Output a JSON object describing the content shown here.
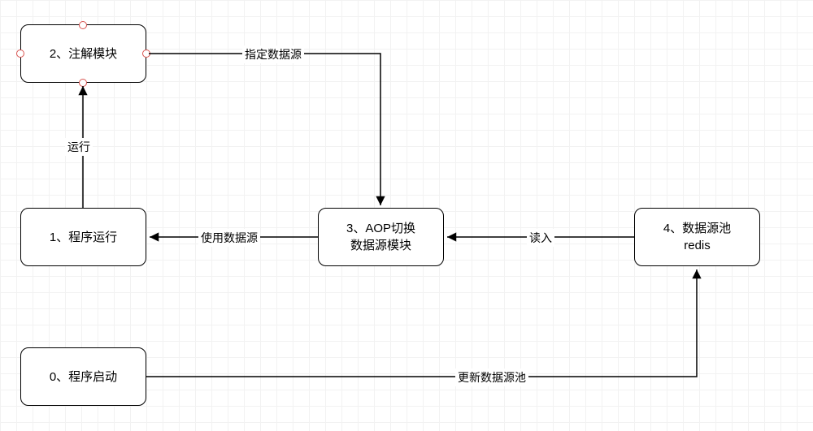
{
  "nodes": {
    "n0": {
      "label": "0、程序启动"
    },
    "n1": {
      "label": "1、程序运行"
    },
    "n2": {
      "label": "2、注解模块"
    },
    "n3": {
      "label": "3、AOP切换\n数据源模块"
    },
    "n4": {
      "label": "4、数据源池\nredis"
    }
  },
  "edges": {
    "e_run": {
      "label": "运行"
    },
    "e_spec": {
      "label": "指定数据源"
    },
    "e_use": {
      "label": "使用数据源"
    },
    "e_read": {
      "label": "读入"
    },
    "e_update": {
      "label": "更新数据源池"
    }
  }
}
